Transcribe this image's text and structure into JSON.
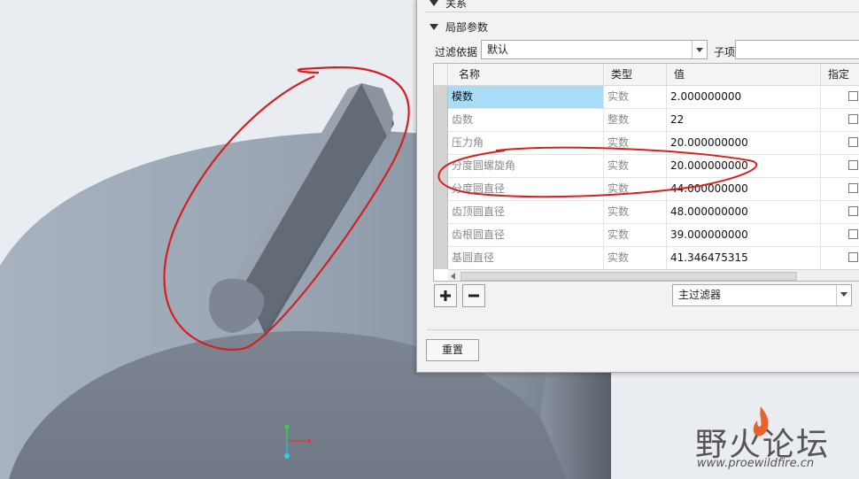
{
  "panel": {
    "top_section": "关系",
    "local_params": "局部参数",
    "filter_label": "过滤依据",
    "filter_value": "默认",
    "subitem_label": "子项",
    "columns": {
      "name": "名称",
      "type": "类型",
      "value": "值",
      "specify": "指定"
    },
    "rows": [
      {
        "name": "模数",
        "type": "实数",
        "value": "2.000000000"
      },
      {
        "name": "齿数",
        "type": "整数",
        "value": "22"
      },
      {
        "name": "压力角",
        "type": "实数",
        "value": "20.000000000"
      },
      {
        "name": "分度圆螺旋角",
        "type": "实数",
        "value": "20.000000000"
      },
      {
        "name": "分度圆直径",
        "type": "实数",
        "value": "44.000000000"
      },
      {
        "name": "齿顶圆直径",
        "type": "实数",
        "value": "48.000000000"
      },
      {
        "name": "齿根圆直径",
        "type": "实数",
        "value": "39.000000000"
      },
      {
        "name": "基圆直径",
        "type": "实数",
        "value": "41.346475315"
      }
    ],
    "add_icon": "plus-icon",
    "remove_icon": "minus-icon",
    "main_filter": "主过滤器",
    "reset_button": "重置"
  },
  "watermark": {
    "brand": "野火论坛",
    "url": "www.proewildfire.cn"
  }
}
